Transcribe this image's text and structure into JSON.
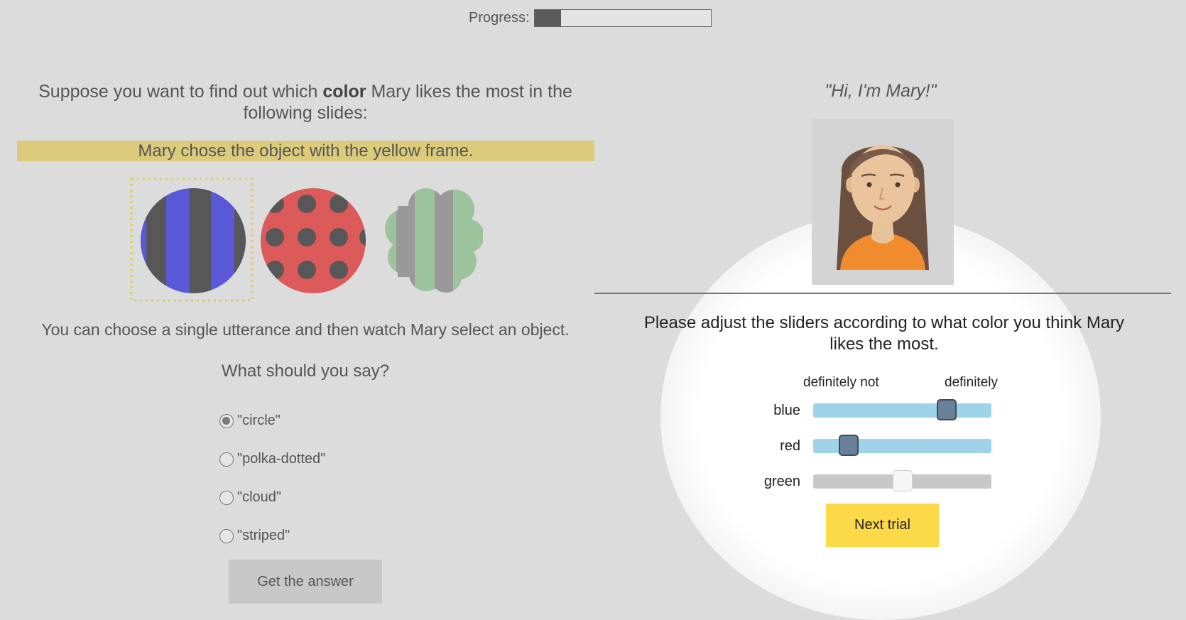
{
  "progress": {
    "label": "Progress:",
    "fraction": 0.15,
    "fill_color": "#5a5a5a"
  },
  "left": {
    "intro_before": "Suppose you want to find out which ",
    "intro_bold": "color",
    "intro_after": " Mary likes the most in the following slides:",
    "choice_banner": "Mary chose the object with the yellow frame.",
    "banner_color": "#dccb7a",
    "objects": [
      {
        "shape": "circle",
        "pattern": "striped",
        "color": "blue",
        "selected": true
      },
      {
        "shape": "circle",
        "pattern": "polka-dotted",
        "color": "red",
        "selected": false
      },
      {
        "shape": "cloud",
        "pattern": "striped",
        "color": "green",
        "selected": false
      }
    ],
    "utterance_info": "You can choose a single utterance and then watch Mary select an object.",
    "question": "What should you say?",
    "options": [
      "\"circle\"",
      "\"polka-dotted\"",
      "\"cloud\"",
      "\"striped\""
    ],
    "selected_option": 0,
    "get_answer_label": "Get the answer"
  },
  "right": {
    "greeting": "\"Hi, I'm Mary!\"",
    "instructions": "Please adjust the sliders according to what color you think Mary likes the most.",
    "scale_low": "definitely not",
    "scale_high": "definitely",
    "sliders": [
      {
        "label": "blue",
        "value": 0.75,
        "active": true
      },
      {
        "label": "red",
        "value": 0.2,
        "active": true
      },
      {
        "label": "green",
        "value": 0.5,
        "active": false
      }
    ],
    "next_label": "Next trial",
    "next_color": "#fcd948"
  }
}
